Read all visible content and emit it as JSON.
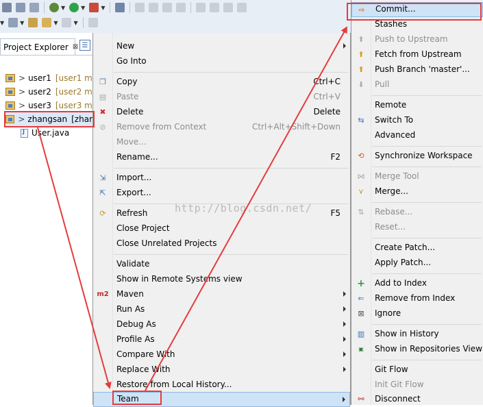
{
  "explorer": {
    "tab_title": "Project Explorer",
    "close_glyph": "⊠",
    "projects": [
      {
        "name": "user1",
        "decoration": "[user1 m"
      },
      {
        "name": "user2",
        "decoration": "[user2 m"
      },
      {
        "name": "user3",
        "decoration": "[user3 m"
      },
      {
        "name": "zhangsan",
        "decoration": "[zhar"
      }
    ],
    "file": "User.java",
    "prefix": ">"
  },
  "context_menu": {
    "items": [
      {
        "label": "New",
        "accel": "",
        "submenu": true,
        "disabled": false
      },
      {
        "label": "Go Into",
        "accel": "",
        "submenu": false,
        "disabled": false
      },
      {
        "label": "Copy",
        "accel": "Ctrl+C",
        "submenu": false,
        "disabled": false
      },
      {
        "label": "Paste",
        "accel": "Ctrl+V",
        "submenu": false,
        "disabled": true
      },
      {
        "label": "Delete",
        "accel": "Delete",
        "submenu": false,
        "disabled": false
      },
      {
        "label": "Remove from Context",
        "accel": "Ctrl+Alt+Shift+Down",
        "submenu": false,
        "disabled": true
      },
      {
        "label": "Move...",
        "accel": "",
        "submenu": false,
        "disabled": true
      },
      {
        "label": "Rename...",
        "accel": "F2",
        "submenu": false,
        "disabled": false
      },
      {
        "label": "Import...",
        "accel": "",
        "submenu": false,
        "disabled": false
      },
      {
        "label": "Export...",
        "accel": "",
        "submenu": false,
        "disabled": false
      },
      {
        "label": "Refresh",
        "accel": "F5",
        "submenu": false,
        "disabled": false
      },
      {
        "label": "Close Project",
        "accel": "",
        "submenu": false,
        "disabled": false
      },
      {
        "label": "Close Unrelated Projects",
        "accel": "",
        "submenu": false,
        "disabled": false
      },
      {
        "label": "Validate",
        "accel": "",
        "submenu": false,
        "disabled": false
      },
      {
        "label": "Show in Remote Systems view",
        "accel": "",
        "submenu": false,
        "disabled": false
      },
      {
        "label": "Maven",
        "accel": "",
        "submenu": true,
        "disabled": false,
        "icon_text": "m2"
      },
      {
        "label": "Run As",
        "accel": "",
        "submenu": true,
        "disabled": false
      },
      {
        "label": "Debug As",
        "accel": "",
        "submenu": true,
        "disabled": false
      },
      {
        "label": "Profile As",
        "accel": "",
        "submenu": true,
        "disabled": false
      },
      {
        "label": "Compare With",
        "accel": "",
        "submenu": true,
        "disabled": false
      },
      {
        "label": "Replace With",
        "accel": "",
        "submenu": true,
        "disabled": false
      },
      {
        "label": "Restore from Local History...",
        "accel": "",
        "submenu": false,
        "disabled": false
      },
      {
        "label": "Team",
        "accel": "",
        "submenu": true,
        "disabled": false
      }
    ]
  },
  "team_menu": {
    "items": [
      {
        "label": "Commit...",
        "disabled": false
      },
      {
        "label": "Stashes",
        "disabled": false
      },
      {
        "label": "Push to Upstream",
        "disabled": true
      },
      {
        "label": "Fetch from Upstream",
        "disabled": false
      },
      {
        "label": "Push Branch 'master'...",
        "disabled": false
      },
      {
        "label": "Pull",
        "disabled": true
      },
      {
        "label": "Remote",
        "disabled": false
      },
      {
        "label": "Switch To",
        "disabled": false
      },
      {
        "label": "Advanced",
        "disabled": false
      },
      {
        "label": "Synchronize Workspace",
        "disabled": false
      },
      {
        "label": "Merge Tool",
        "disabled": true
      },
      {
        "label": "Merge...",
        "disabled": false
      },
      {
        "label": "Rebase...",
        "disabled": true
      },
      {
        "label": "Reset...",
        "disabled": true
      },
      {
        "label": "Create Patch...",
        "disabled": false
      },
      {
        "label": "Apply Patch...",
        "disabled": false
      },
      {
        "label": "Add to Index",
        "disabled": false
      },
      {
        "label": "Remove from Index",
        "disabled": false
      },
      {
        "label": "Ignore",
        "disabled": false
      },
      {
        "label": "Show in History",
        "disabled": false
      },
      {
        "label": "Show in Repositories View",
        "disabled": false
      },
      {
        "label": "Git Flow",
        "disabled": false
      },
      {
        "label": "Init Git Flow",
        "disabled": true
      },
      {
        "label": "Disconnect",
        "disabled": false
      }
    ]
  },
  "watermark": "http://blog.csdn.net/",
  "colors": {
    "annotation_red": "#e53b3b",
    "menu_bg": "#f0f0f0",
    "toolbar_bg": "#e8eef6",
    "disabled_text": "#8d8d8d"
  }
}
